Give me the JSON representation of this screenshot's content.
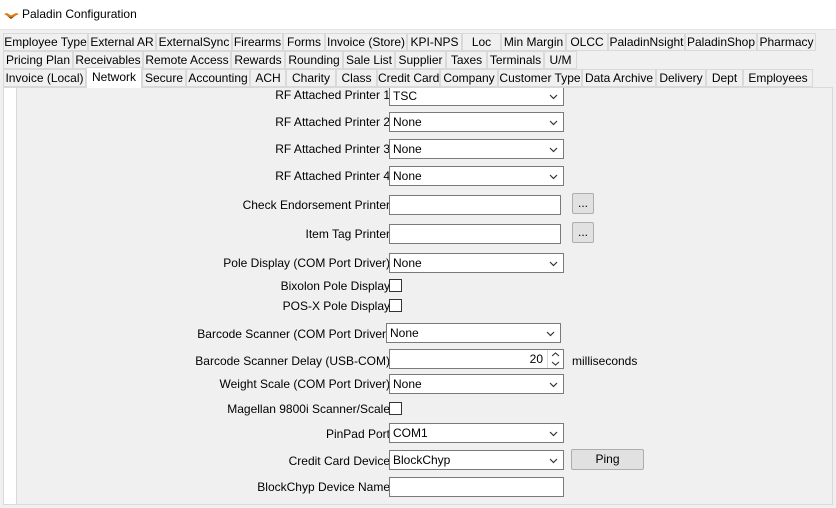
{
  "window": {
    "title": "Paladin Configuration"
  },
  "tabs": {
    "row1": [
      "Employee Type",
      "External AR",
      "ExternalSync",
      "Firearms",
      "Forms",
      "Invoice (Store)",
      "KPI-NPS",
      "Loc",
      "Min Margin",
      "OLCC",
      "PaladinNsight",
      "PaladinShop",
      "Pharmacy"
    ],
    "row2": [
      "Pricing Plan",
      "Receivables",
      "Remote Access",
      "Rewards",
      "Rounding",
      "Sale List",
      "Supplier",
      "Taxes",
      "Terminals",
      "U/M"
    ],
    "row3": [
      "Invoice (Local)",
      "Network",
      "Secure",
      "Accounting",
      "ACH",
      "Charity",
      "Class",
      "Credit Card",
      "Company",
      "Customer Type",
      "Data Archive",
      "Delivery",
      "Dept",
      "Employees"
    ],
    "selected": "Network"
  },
  "form": {
    "rf1": {
      "label": "RF Attached Printer 1",
      "value": "TSC"
    },
    "rf2": {
      "label": "RF Attached Printer 2",
      "value": "None"
    },
    "rf3": {
      "label": "RF Attached Printer 3",
      "value": "None"
    },
    "rf4": {
      "label": "RF Attached Printer 4",
      "value": "None"
    },
    "check_printer": {
      "label": "Check Endorsement Printer",
      "value": "",
      "browse": "..."
    },
    "item_tag_printer": {
      "label": "Item Tag Printer",
      "value": "",
      "browse": "..."
    },
    "pole_display": {
      "label": "Pole Display (COM Port Driver)",
      "value": "None"
    },
    "bixolon": {
      "label": "Bixolon Pole Display",
      "checked": false
    },
    "posx": {
      "label": "POS-X Pole Display",
      "checked": false
    },
    "barcode_scanner": {
      "label": "Barcode Scanner (COM Port Driver)",
      "value": "None"
    },
    "barcode_delay": {
      "label": "Barcode Scanner Delay (USB-COM)",
      "value": "20",
      "units": "milliseconds"
    },
    "weight_scale": {
      "label": "Weight Scale (COM Port Driver)",
      "value": "None"
    },
    "magellan": {
      "label": "Magellan 9800i Scanner/Scale",
      "checked": false
    },
    "pinpad_port": {
      "label": "PinPad Port",
      "value": "COM1"
    },
    "cc_device": {
      "label": "Credit Card Device",
      "value": "BlockChyp",
      "ping": "Ping"
    },
    "blockchyp_name": {
      "label": "BlockChyp Device Name",
      "value": ""
    }
  }
}
